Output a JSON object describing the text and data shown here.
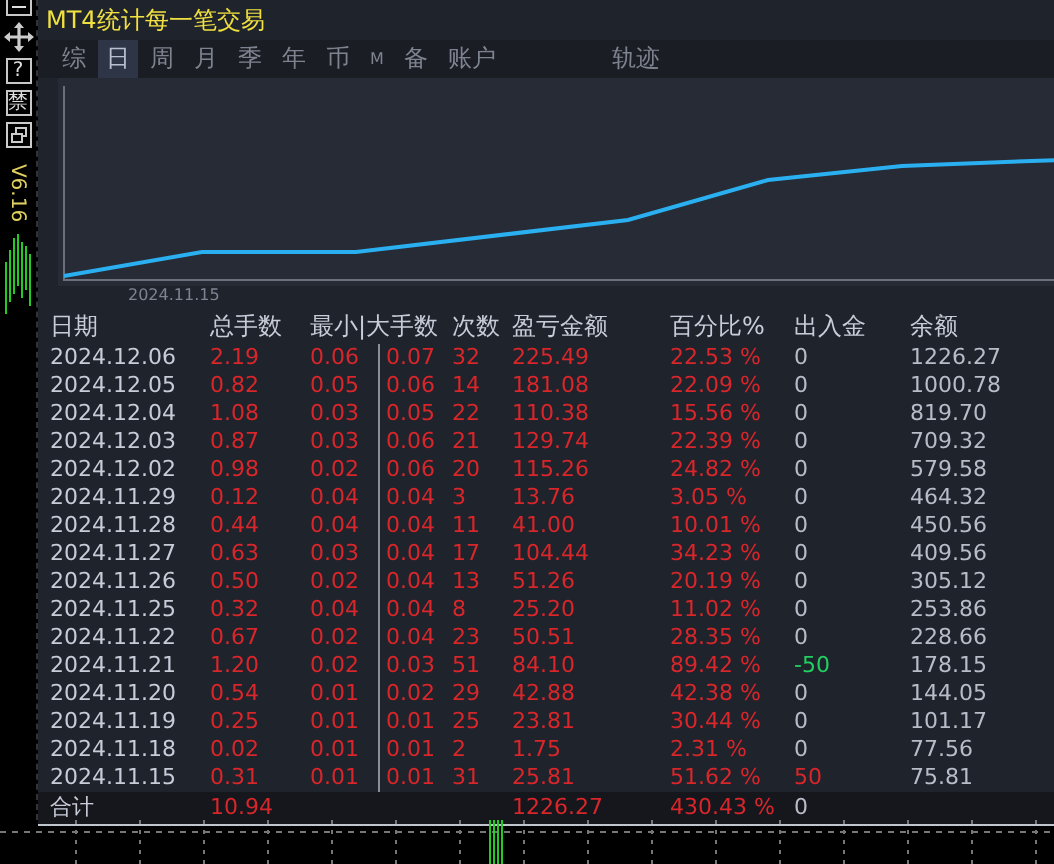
{
  "window": {
    "title": "MT4统计每一笔交易",
    "version": "V6.16"
  },
  "side_toolbar": [
    {
      "kind": "minimize"
    },
    {
      "kind": "move"
    },
    {
      "kind": "text",
      "label": "?"
    },
    {
      "kind": "text",
      "label": "禁"
    },
    {
      "kind": "restore"
    }
  ],
  "tabs": [
    {
      "label": "综",
      "selected": false
    },
    {
      "label": "日",
      "selected": true
    },
    {
      "label": "周",
      "selected": false
    },
    {
      "label": "月",
      "selected": false
    },
    {
      "label": "季",
      "selected": false
    },
    {
      "label": "年",
      "selected": false
    },
    {
      "label": "币",
      "selected": false
    },
    {
      "label": "M",
      "selected": false
    },
    {
      "label": "备",
      "selected": false
    },
    {
      "label": "账户",
      "selected": false
    },
    {
      "label": "轨迹",
      "selected": false
    }
  ],
  "chart": {
    "x_label": "2024.11.15"
  },
  "table": {
    "columns": [
      "日期",
      "总手数",
      "最小|大手数",
      "次数",
      "盈亏金额",
      "百分比%",
      "出入金",
      "余额"
    ],
    "rows": [
      {
        "date": "2024.12.06",
        "lots": "2.19",
        "min": "0.06",
        "max": "0.07",
        "count": "32",
        "profit": "225.49",
        "percent": "22.53 %",
        "flow": "0",
        "kind": "zero",
        "balance": "1226.27"
      },
      {
        "date": "2024.12.05",
        "lots": "0.82",
        "min": "0.05",
        "max": "0.06",
        "count": "14",
        "profit": "181.08",
        "percent": "22.09 %",
        "flow": "0",
        "kind": "zero",
        "balance": "1000.78"
      },
      {
        "date": "2024.12.04",
        "lots": "1.08",
        "min": "0.03",
        "max": "0.05",
        "count": "22",
        "profit": "110.38",
        "percent": "15.56 %",
        "flow": "0",
        "kind": "zero",
        "balance": "819.70"
      },
      {
        "date": "2024.12.03",
        "lots": "0.87",
        "min": "0.03",
        "max": "0.06",
        "count": "21",
        "profit": "129.74",
        "percent": "22.39 %",
        "flow": "0",
        "kind": "zero",
        "balance": "709.32"
      },
      {
        "date": "2024.12.02",
        "lots": "0.98",
        "min": "0.02",
        "max": "0.06",
        "count": "20",
        "profit": "115.26",
        "percent": "24.82 %",
        "flow": "0",
        "kind": "zero",
        "balance": "579.58"
      },
      {
        "date": "2024.11.29",
        "lots": "0.12",
        "min": "0.04",
        "max": "0.04",
        "count": "3",
        "profit": "13.76",
        "percent": "3.05 %",
        "flow": "0",
        "kind": "zero",
        "balance": "464.32"
      },
      {
        "date": "2024.11.28",
        "lots": "0.44",
        "min": "0.04",
        "max": "0.04",
        "count": "11",
        "profit": "41.00",
        "percent": "10.01 %",
        "flow": "0",
        "kind": "zero",
        "balance": "450.56"
      },
      {
        "date": "2024.11.27",
        "lots": "0.63",
        "min": "0.03",
        "max": "0.04",
        "count": "17",
        "profit": "104.44",
        "percent": "34.23 %",
        "flow": "0",
        "kind": "zero",
        "balance": "409.56"
      },
      {
        "date": "2024.11.26",
        "lots": "0.50",
        "min": "0.02",
        "max": "0.04",
        "count": "13",
        "profit": "51.26",
        "percent": "20.19 %",
        "flow": "0",
        "kind": "zero",
        "balance": "305.12"
      },
      {
        "date": "2024.11.25",
        "lots": "0.32",
        "min": "0.04",
        "max": "0.04",
        "count": "8",
        "profit": "25.20",
        "percent": "11.02 %",
        "flow": "0",
        "kind": "zero",
        "balance": "253.86"
      },
      {
        "date": "2024.11.22",
        "lots": "0.67",
        "min": "0.02",
        "max": "0.04",
        "count": "23",
        "profit": "50.51",
        "percent": "28.35 %",
        "flow": "0",
        "kind": "zero",
        "balance": "228.66"
      },
      {
        "date": "2024.11.21",
        "lots": "1.20",
        "min": "0.02",
        "max": "0.03",
        "count": "51",
        "profit": "84.10",
        "percent": "89.42 %",
        "flow": "-50",
        "kind": "out",
        "balance": "178.15"
      },
      {
        "date": "2024.11.20",
        "lots": "0.54",
        "min": "0.01",
        "max": "0.02",
        "count": "29",
        "profit": "42.88",
        "percent": "42.38 %",
        "flow": "0",
        "kind": "zero",
        "balance": "144.05"
      },
      {
        "date": "2024.11.19",
        "lots": "0.25",
        "min": "0.01",
        "max": "0.01",
        "count": "25",
        "profit": "23.81",
        "percent": "30.44 %",
        "flow": "0",
        "kind": "zero",
        "balance": "101.17"
      },
      {
        "date": "2024.11.18",
        "lots": "0.02",
        "min": "0.01",
        "max": "0.01",
        "count": "2",
        "profit": "1.75",
        "percent": "2.31 %",
        "flow": "0",
        "kind": "zero",
        "balance": "77.56"
      },
      {
        "date": "2024.11.15",
        "lots": "0.31",
        "min": "0.01",
        "max": "0.01",
        "count": "31",
        "profit": "25.81",
        "percent": "51.62 %",
        "flow": "50",
        "kind": "in",
        "balance": "75.81"
      }
    ],
    "total": {
      "label": "合计",
      "lots": "10.94",
      "profit": "1226.27",
      "percent": "430.43 %",
      "flow": "0"
    }
  }
}
